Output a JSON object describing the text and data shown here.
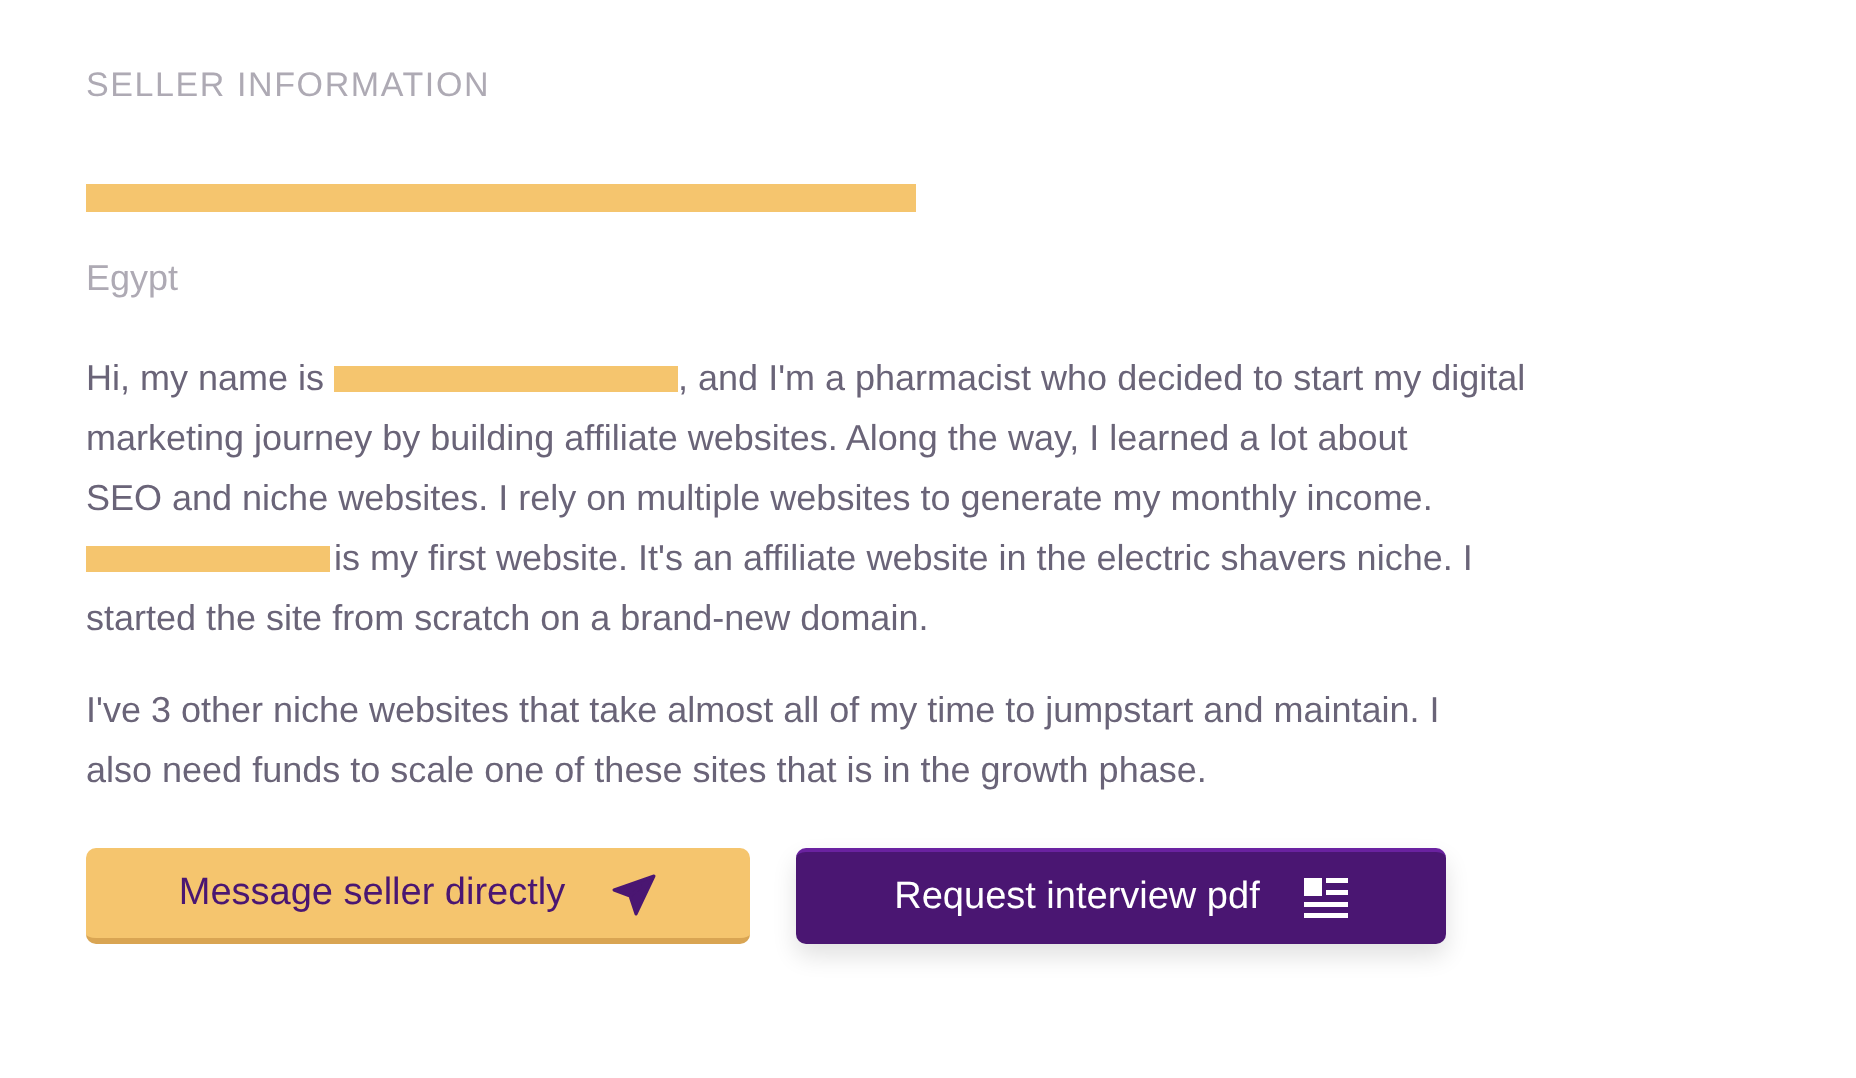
{
  "section_title": "SELLER INFORMATION",
  "seller_name": {
    "kind": "redacted"
  },
  "country": "Egypt",
  "paragraphs": [
    [
      {
        "kind": "text",
        "text": "Hi, my name is "
      },
      {
        "kind": "redacted"
      },
      {
        "kind": "text",
        "text": ", and I'm a pharmacist who decided to start my digital"
      },
      {
        "kind": "break"
      },
      {
        "kind": "text",
        "text": "marketing journey by building affiliate websites. Along the way, I learned a lot about"
      },
      {
        "kind": "break"
      },
      {
        "kind": "text",
        "text": "SEO and niche websites. I rely on multiple websites to generate my monthly income."
      },
      {
        "kind": "break"
      },
      {
        "kind": "redacted"
      },
      {
        "kind": "text",
        "text": "is my first website. It's an affiliate website in the electric shavers niche. I"
      },
      {
        "kind": "break"
      },
      {
        "kind": "text",
        "text": "started the site from scratch on a brand-new domain."
      }
    ],
    [
      {
        "kind": "text",
        "text": "I've 3 other niche websites that take almost all of my time to jumpstart and maintain. I"
      },
      {
        "kind": "break"
      },
      {
        "kind": "text",
        "text": "also need funds to scale one of these sites that is in the growth phase."
      }
    ]
  ],
  "buttons": [
    {
      "label": "Message seller directly",
      "kind": "message"
    },
    {
      "label": "Request interview pdf",
      "kind": "pdf"
    }
  ]
}
